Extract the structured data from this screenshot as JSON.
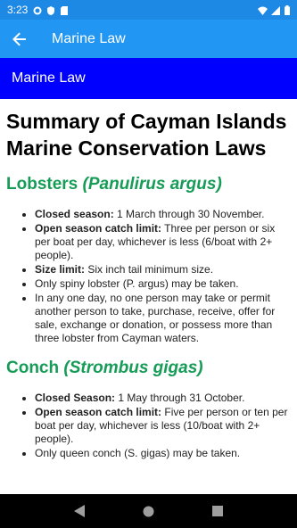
{
  "status": {
    "time": "3:23"
  },
  "appbar": {
    "title": "Marine Law"
  },
  "section_bar": {
    "label": "Marine Law"
  },
  "page": {
    "title": "Summary of Cayman Islands Marine Conservation Laws",
    "lobsters": {
      "heading": "Lobsters ",
      "heading_italic": "(Panulirus argus)",
      "items": [
        {
          "bold": "Closed season:",
          "text": " 1 March through 30 November."
        },
        {
          "bold": "Open season catch limit:",
          "text": " Three per person or six per boat per day, whichever is less (6/boat with 2+ people)."
        },
        {
          "bold": "Size limit:",
          "text": " Six inch tail minimum size."
        },
        {
          "bold": "",
          "text": "Only spiny lobster (P. argus) may be taken."
        },
        {
          "bold": "",
          "text": "In any one day, no one person may take or permit another person to take, purchase, receive, offer for sale, exchange or donation, or possess more than three lobster from Cayman waters."
        }
      ]
    },
    "conch": {
      "heading": "Conch ",
      "heading_italic": "(Strombus gigas)",
      "items": [
        {
          "bold": "Closed Season:",
          "text": " 1 May through 31 October."
        },
        {
          "bold": "Open season catch limit:",
          "text": " Five per person or ten per boat per day, whichever is less (10/boat with 2+ people)."
        },
        {
          "bold": "",
          "text": "Only queen conch (S. gigas) may be taken."
        }
      ]
    }
  }
}
